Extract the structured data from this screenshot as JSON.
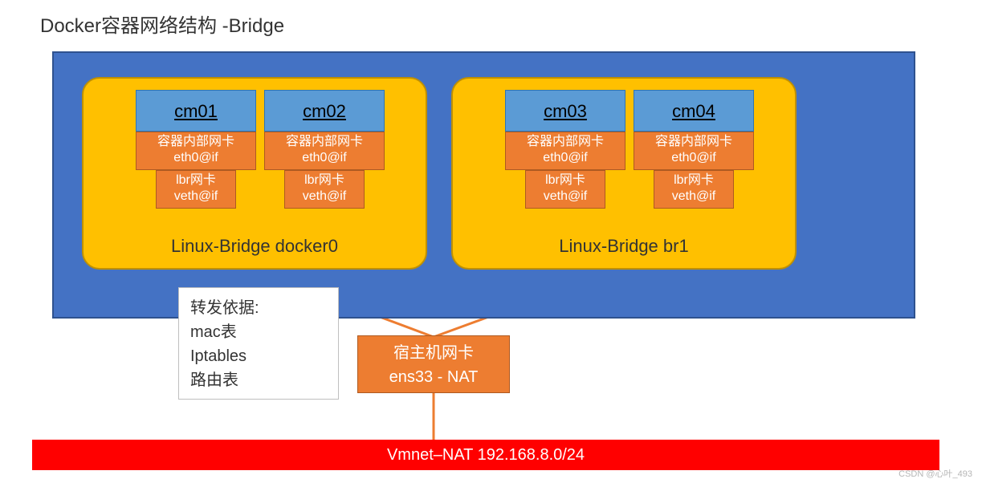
{
  "title": "Docker容器网络结构 -Bridge",
  "bridges": [
    {
      "label": "Linux-Bridge docker0",
      "containers": [
        {
          "name": "cm01",
          "eth_l1": "容器内部网卡",
          "eth_l2": "eth0@if",
          "veth_l1": "lbr网卡",
          "veth_l2": "veth@if"
        },
        {
          "name": "cm02",
          "eth_l1": "容器内部网卡",
          "eth_l2": "eth0@if",
          "veth_l1": "lbr网卡",
          "veth_l2": "veth@if"
        }
      ]
    },
    {
      "label": "Linux-Bridge br1",
      "containers": [
        {
          "name": "cm03",
          "eth_l1": "容器内部网卡",
          "eth_l2": "eth0@if",
          "veth_l1": "lbr网卡",
          "veth_l2": "veth@if"
        },
        {
          "name": "cm04",
          "eth_l1": "容器内部网卡",
          "eth_l2": "eth0@if",
          "veth_l1": "lbr网卡",
          "veth_l2": "veth@if"
        }
      ]
    }
  ],
  "forward_rules": {
    "title": "转发依据:",
    "l1": "mac表",
    "l2": "Iptables",
    "l3": "路由表"
  },
  "host_nic": {
    "l1": "宿主机网卡",
    "l2": "ens33 - NAT"
  },
  "vmnet": "Vmnet–NAT  192.168.8.0/24",
  "watermark": "CSDN @心叶_493",
  "colors": {
    "host": "#4472C4",
    "bridge": "#FFC000",
    "cm": "#5B9BD5",
    "nic": "#ED7D31",
    "vmnet": "#FF0000"
  }
}
